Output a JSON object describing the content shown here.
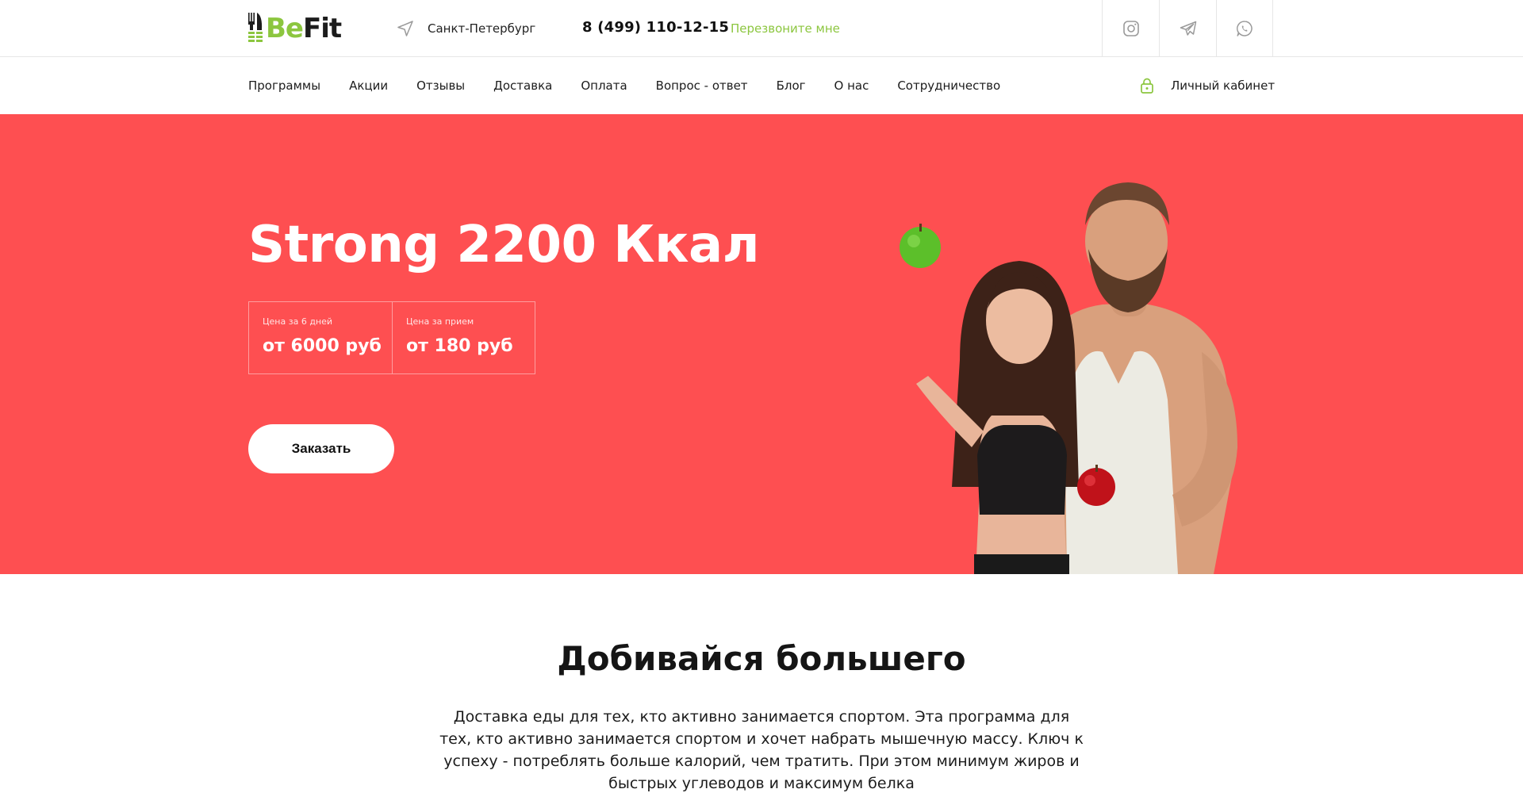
{
  "brand": {
    "part1": "Be",
    "part2": "Fit",
    "accent": "#8cc63f"
  },
  "header": {
    "city": "Санкт-Петербург",
    "city_icon": "location-arrow-icon",
    "phone": "8 (499) 110-12-15",
    "callback": "Перезвоните мне",
    "socials": [
      "instagram-icon",
      "telegram-icon",
      "whatsapp-icon"
    ]
  },
  "nav": {
    "items": [
      "Программы",
      "Акции",
      "Отзывы",
      "Доставка",
      "Оплата",
      "Вопрос - ответ",
      "Блог",
      "О нас",
      "Сотрудничество"
    ],
    "cabinet": "Личный кабинет",
    "cabinet_icon": "lock-icon"
  },
  "hero": {
    "background": "#fe4f51",
    "title": "Strong 2200 Ккал",
    "prices": [
      {
        "caption": "Цена за 6 дней",
        "value": "от 6000 руб"
      },
      {
        "caption": "Цена за прием",
        "value": "от 180 руб"
      }
    ],
    "order_button": "Заказать"
  },
  "about": {
    "title": "Добивайся большего",
    "text": "Доставка еды для тех, кто активно занимается спортом. Эта программа для тех, кто активно занимается спортом и хочет набрать мышечную массу. Ключ к успеху - потреблять больше калорий, чем тратить. При этом минимум жиров и быстрых углеводов и максимум белка"
  }
}
